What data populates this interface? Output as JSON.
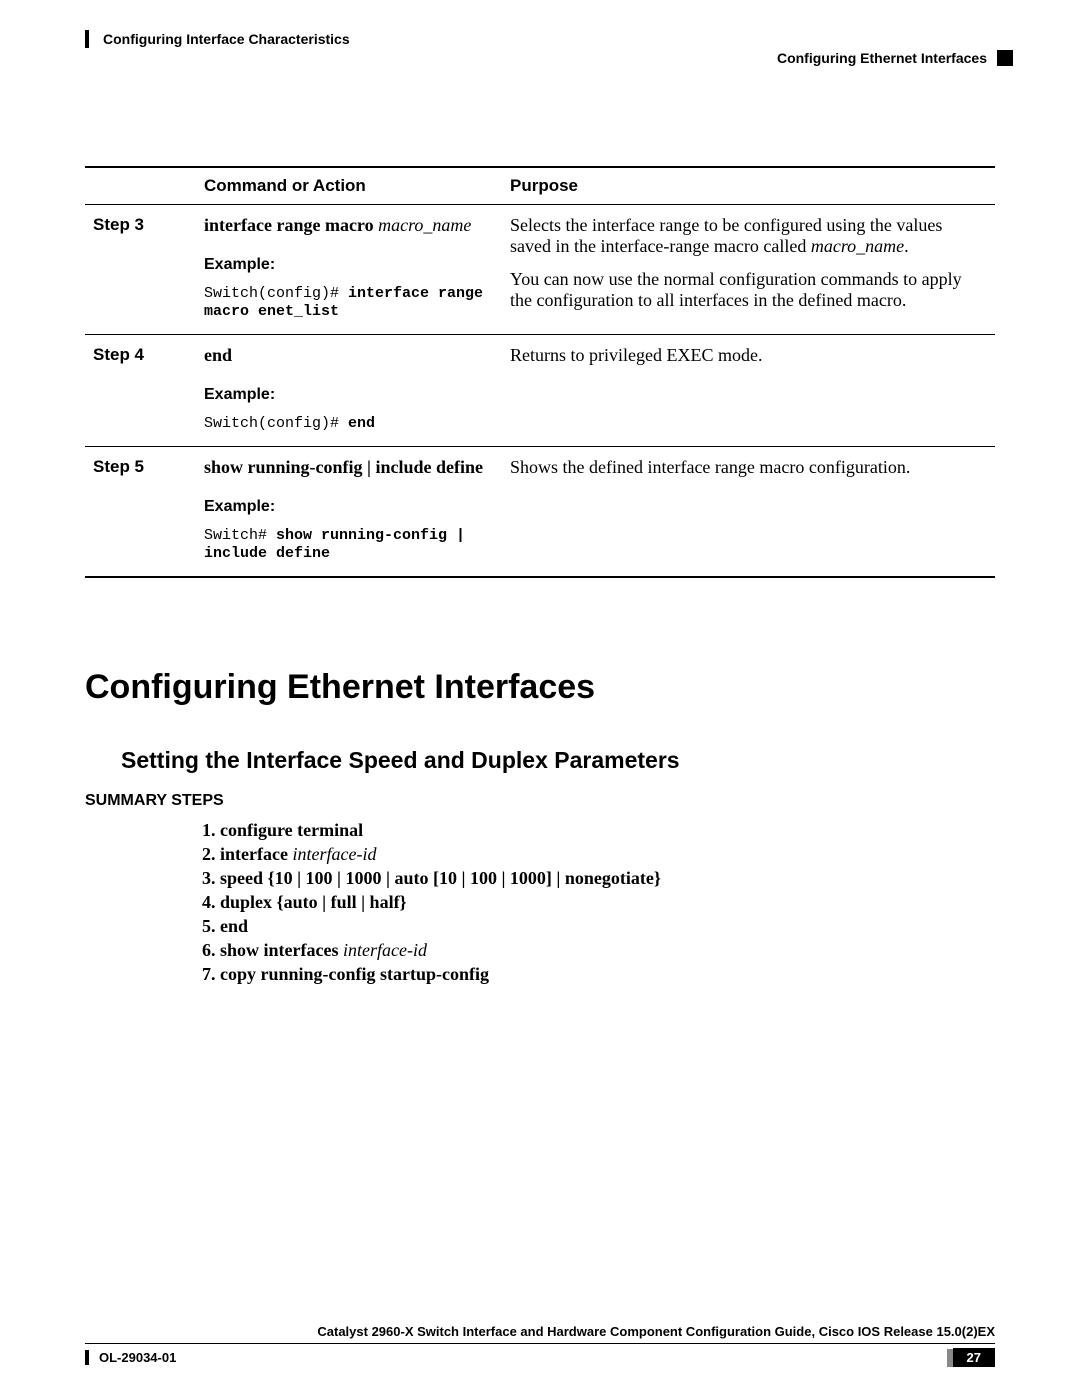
{
  "header": {
    "left": "Configuring Interface Characteristics",
    "right": "Configuring Ethernet Interfaces"
  },
  "table": {
    "th_command": "Command or Action",
    "th_purpose": "Purpose",
    "rows": [
      {
        "step": "Step 3",
        "cmd_bold": "interface range macro ",
        "cmd_italic": "macro_name",
        "example_label": "Example:",
        "example_prompt": "Switch(config)# ",
        "example_cmd": "interface range macro enet_list",
        "purpose_1a": "Selects the interface range to be configured using the values saved in the interface-range macro called ",
        "purpose_1b": "macro_name",
        "purpose_1c": ".",
        "purpose_2": "You can now use the normal configuration commands to apply the configuration to all interfaces in the defined macro."
      },
      {
        "step": "Step 4",
        "cmd_bold": "end",
        "cmd_italic": "",
        "example_label": "Example:",
        "example_prompt": "Switch(config)# ",
        "example_cmd": "end",
        "purpose_1a": "Returns to privileged EXEC mode.",
        "purpose_1b": "",
        "purpose_1c": "",
        "purpose_2": ""
      },
      {
        "step": "Step 5",
        "cmd_bold": "show running-config | include define",
        "cmd_italic": "",
        "example_label": "Example:",
        "example_prompt": "Switch# ",
        "example_cmd": "show running-config | include define",
        "purpose_1a": "Shows the defined interface range macro configuration.",
        "purpose_1b": "",
        "purpose_1c": "",
        "purpose_2": ""
      }
    ]
  },
  "section": {
    "title": "Configuring Ethernet Interfaces",
    "subtitle": "Setting the Interface Speed and Duplex Parameters",
    "summary_label": "SUMMARY STEPS",
    "steps": [
      {
        "bold": "configure terminal",
        "italic": ""
      },
      {
        "bold": "interface ",
        "italic": "interface-id"
      },
      {
        "bold": "speed {10 | 100 | 1000 | auto [10 | 100 | 1000] | nonegotiate}",
        "italic": ""
      },
      {
        "bold": "duplex {auto | full | half}",
        "italic": ""
      },
      {
        "bold": "end",
        "italic": ""
      },
      {
        "bold": "show interfaces ",
        "italic": "interface-id"
      },
      {
        "bold": "copy running-config startup-config",
        "italic": ""
      }
    ]
  },
  "footer": {
    "guide": "Catalyst 2960-X Switch Interface and Hardware Component Configuration Guide, Cisco IOS Release 15.0(2)EX",
    "doc_id": "OL-29034-01",
    "page": "27"
  }
}
